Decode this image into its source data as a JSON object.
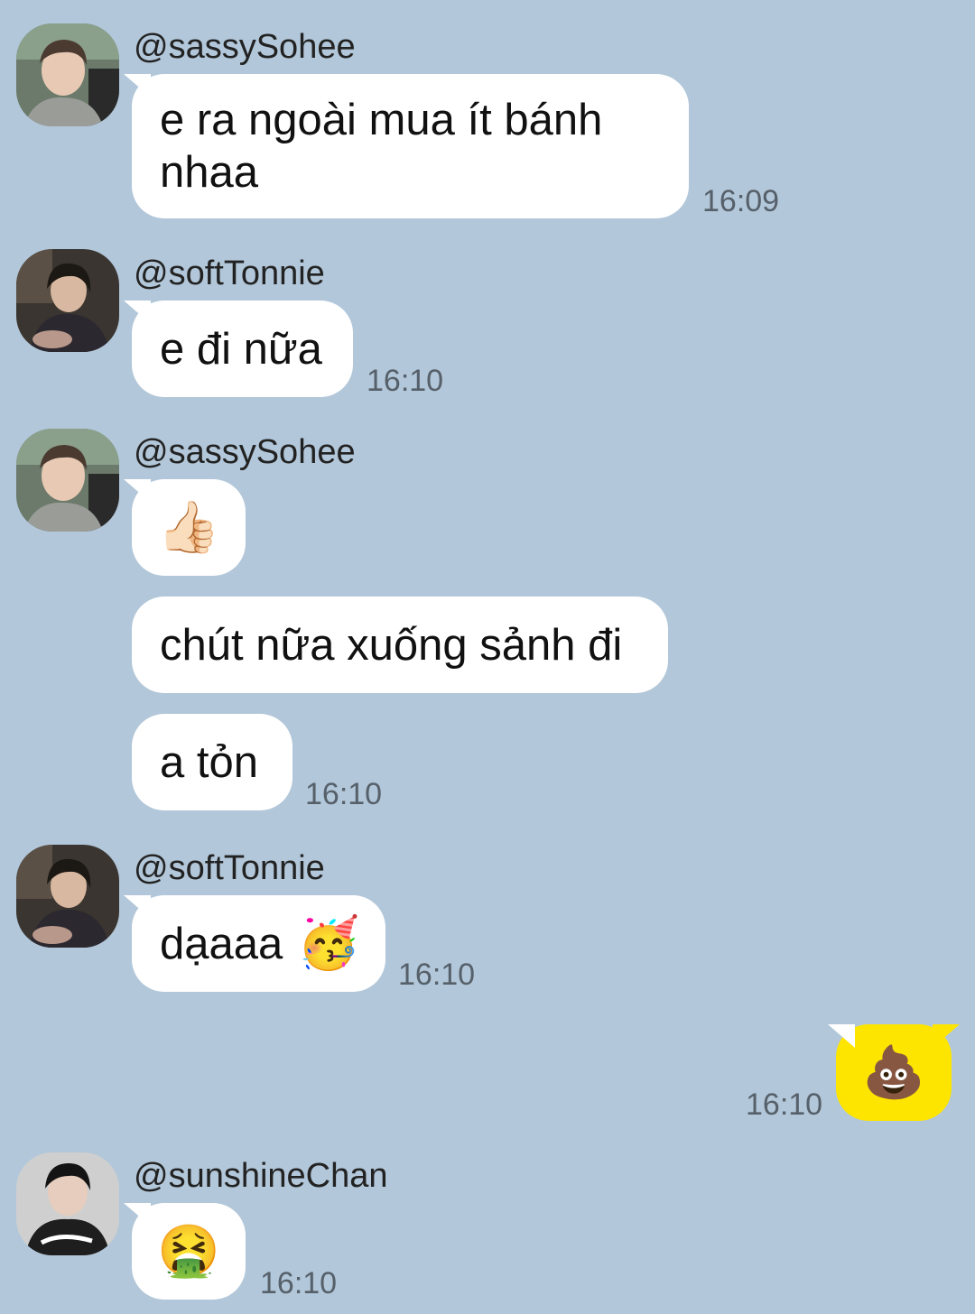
{
  "chat": {
    "messages": [
      {
        "sender": "@sassySohee",
        "text": "e ra ngoài mua ít bánh nhaa",
        "time": "16:09"
      },
      {
        "sender": "@softTonnie",
        "text": "e đi nữa",
        "time": "16:10"
      },
      {
        "sender": "@sassySohee",
        "emoji": "👍🏻"
      },
      {
        "text": "chút nữa xuống sảnh đi"
      },
      {
        "text": "a tỏn",
        "time": "16:10"
      },
      {
        "sender": "@softTonnie",
        "text": "dạaaa",
        "emoji": "🥳",
        "time": "16:10"
      },
      {
        "outgoing": true,
        "emoji": "💩",
        "time": "16:10"
      },
      {
        "sender": "@sunshineChan",
        "emoji": "🤮",
        "time": "16:10"
      }
    ]
  },
  "theme": {
    "background": "#b2c7d9",
    "incoming_bubble": "#ffffff",
    "outgoing_bubble": "#fee500"
  },
  "icons": {
    "avatar_sohee": "avatar-photo-icon",
    "avatar_tonnie": "avatar-photo-icon",
    "avatar_chan": "avatar-photo-icon"
  }
}
